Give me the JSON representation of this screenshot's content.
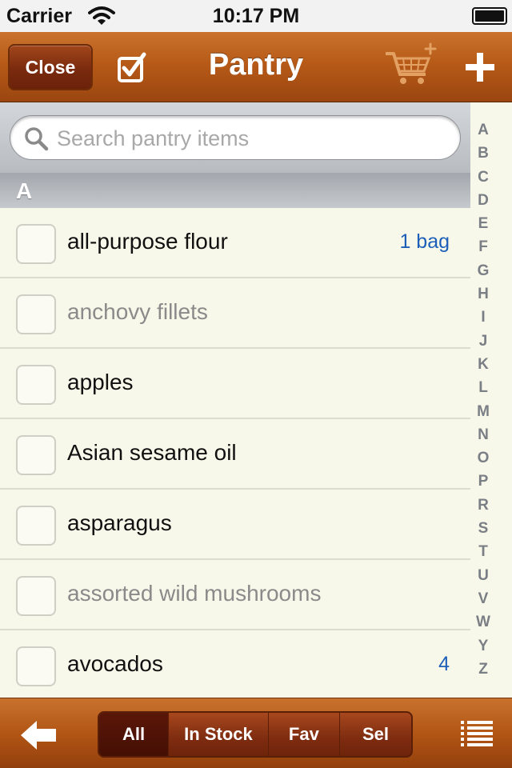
{
  "status_bar": {
    "carrier": "Carrier",
    "time": "10:17 PM"
  },
  "nav": {
    "close_label": "Close",
    "title": "Pantry"
  },
  "search": {
    "placeholder": "Search pantry items"
  },
  "section": {
    "letter": "A"
  },
  "index_letters": [
    "A",
    "B",
    "C",
    "D",
    "E",
    "F",
    "G",
    "H",
    "I",
    "J",
    "K",
    "L",
    "M",
    "N",
    "O",
    "P",
    "R",
    "S",
    "T",
    "U",
    "V",
    "W",
    "Y",
    "Z"
  ],
  "items": [
    {
      "name": "all-purpose flour",
      "qty": "1 bag",
      "muted": false
    },
    {
      "name": "anchovy fillets",
      "qty": "",
      "muted": true
    },
    {
      "name": "apples",
      "qty": "",
      "muted": false
    },
    {
      "name": "Asian sesame oil",
      "qty": "",
      "muted": false
    },
    {
      "name": "asparagus",
      "qty": "",
      "muted": false
    },
    {
      "name": "assorted wild mushrooms",
      "qty": "",
      "muted": true
    },
    {
      "name": "avocados",
      "qty": "4",
      "muted": false
    }
  ],
  "toolbar": {
    "segments": [
      {
        "label": "All",
        "selected": true
      },
      {
        "label": "In Stock",
        "selected": false
      },
      {
        "label": "Fav",
        "selected": false
      },
      {
        "label": "Sel",
        "selected": false
      }
    ]
  },
  "colors": {
    "accent": "#b75a18",
    "quantity": "#1d5fb8",
    "row_bg": "#f8f8ea"
  },
  "icons": [
    "wifi-icon",
    "battery-icon",
    "checkmark-icon",
    "add-to-cart-icon",
    "plus-icon",
    "search-icon",
    "back-arrow-icon",
    "list-icon"
  ]
}
